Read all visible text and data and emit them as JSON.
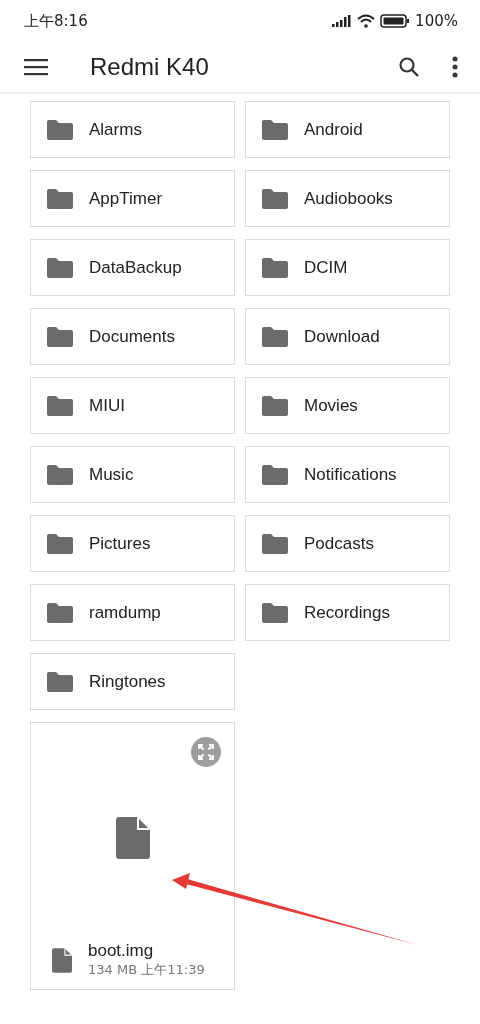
{
  "status_bar": {
    "time": "上午8:16",
    "battery": "100%"
  },
  "app_bar": {
    "title": "Redmi K40"
  },
  "folders": [
    {
      "name": "Alarms"
    },
    {
      "name": "Android"
    },
    {
      "name": "AppTimer"
    },
    {
      "name": "Audiobooks"
    },
    {
      "name": "DataBackup"
    },
    {
      "name": "DCIM"
    },
    {
      "name": "Documents"
    },
    {
      "name": "Download"
    },
    {
      "name": "MIUI"
    },
    {
      "name": "Movies"
    },
    {
      "name": "Music"
    },
    {
      "name": "Notifications"
    },
    {
      "name": "Pictures"
    },
    {
      "name": "Podcasts"
    },
    {
      "name": "ramdump"
    },
    {
      "name": "Recordings"
    },
    {
      "name": "Ringtones"
    }
  ],
  "files": [
    {
      "name": "boot.img",
      "details": "134 MB 上午11:39"
    }
  ]
}
